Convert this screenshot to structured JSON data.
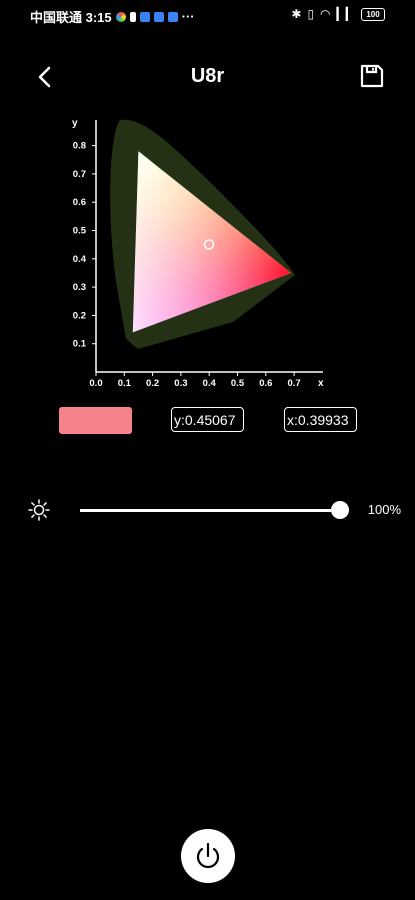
{
  "status_bar": {
    "carrier_time": "中国联通 3:15",
    "more": "···",
    "battery": "100"
  },
  "header": {
    "title": "U8r"
  },
  "chart_data": {
    "type": "scatter",
    "title": "",
    "xlabel": "x",
    "ylabel": "y",
    "xlim": [
      0,
      0.8
    ],
    "ylim": [
      0,
      0.9
    ],
    "x_ticks": [
      "0.0",
      "0.1",
      "0.2",
      "0.3",
      "0.4",
      "0.5",
      "0.6",
      "0.7"
    ],
    "y_ticks": [
      "0.1",
      "0.2",
      "0.3",
      "0.4",
      "0.5",
      "0.6",
      "0.7",
      "0.8"
    ],
    "gamut_triangle": [
      {
        "x": 0.15,
        "y": 0.78
      },
      {
        "x": 0.69,
        "y": 0.35
      },
      {
        "x": 0.13,
        "y": 0.14
      }
    ],
    "selected_point": {
      "x": 0.39933,
      "y": 0.45067
    }
  },
  "color": {
    "preview": "#f6828c"
  },
  "coords": {
    "y_label": "y:0.45067",
    "x_label": "x:0.39933"
  },
  "brightness": {
    "value": 1.0,
    "label": "100%"
  }
}
